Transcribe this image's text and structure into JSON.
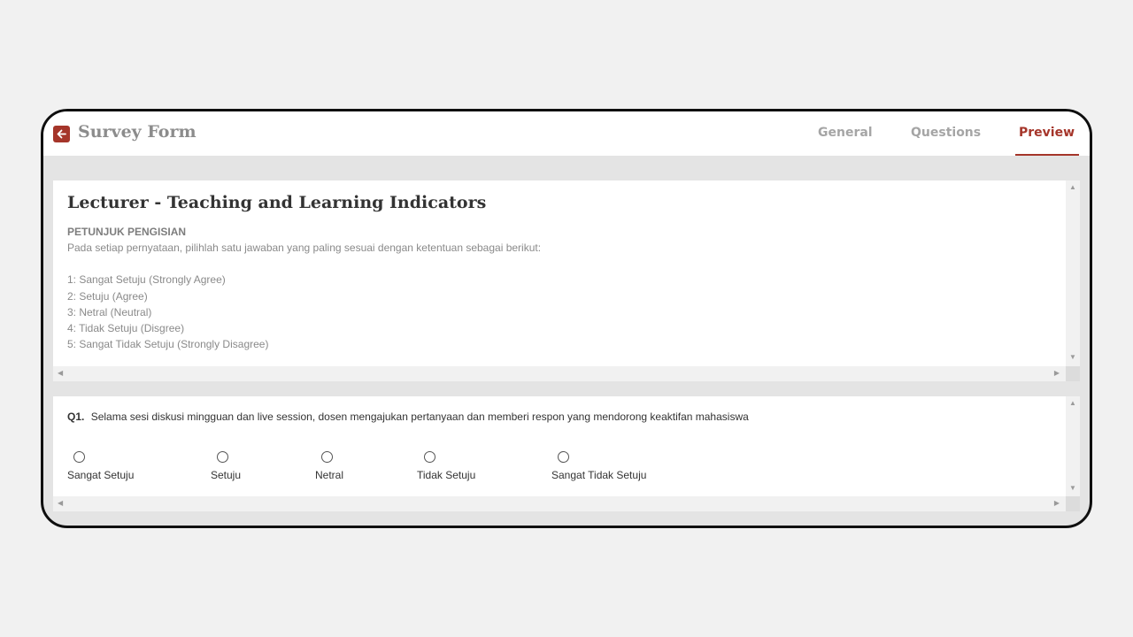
{
  "app": {
    "title": "Survey Form",
    "accent_color": "#a5352a",
    "back_icon": "arrow-left-icon"
  },
  "tabs": [
    {
      "label": "General",
      "active": false
    },
    {
      "label": "Questions",
      "active": false
    },
    {
      "label": "Preview",
      "active": true
    }
  ],
  "survey": {
    "title": "Lecturer - Teaching and Learning Indicators",
    "instructions_heading": "PETUNJUK PENGISIAN",
    "instructions_intro": "Pada setiap pernyataan, pilihlah satu jawaban yang paling sesuai dengan ketentuan sebagai berikut:",
    "scale": [
      "1: Sangat Setuju (Strongly Agree)",
      "2: Setuju (Agree)",
      "3: Netral (Neutral)",
      "4: Tidak Setuju (Disgree)",
      "5: Sangat Tidak Setuju (Strongly Disagree)"
    ]
  },
  "question": {
    "number": "Q1.",
    "text": "Selama sesi diskusi mingguan dan live session, dosen mengajukan pertanyaan dan memberi respon yang mendorong keaktifan mahasiswa",
    "options": [
      "Sangat Setuju",
      "Setuju",
      "Netral",
      "Tidak Setuju",
      "Sangat Tidak Setuju"
    ],
    "selected": null
  }
}
